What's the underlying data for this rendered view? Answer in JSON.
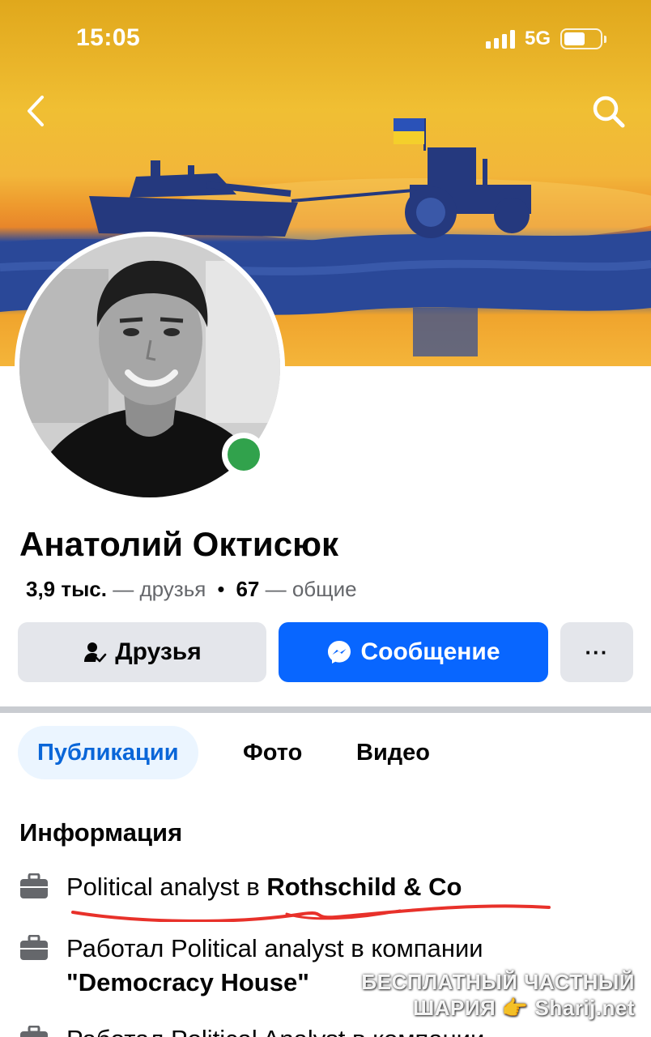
{
  "status_bar": {
    "time": "15:05",
    "network": "5G"
  },
  "profile": {
    "name": "Анатолий Октисюк",
    "friends_count": "3,9 тыс.",
    "friends_label": "— друзья",
    "separator": "•",
    "mutual_count": "67",
    "mutual_label": "— общие",
    "online": true
  },
  "actions": {
    "friends_label": "Друзья",
    "message_label": "Сообщение",
    "more_label": "···"
  },
  "tabs": [
    {
      "label": "Публикации",
      "active": true
    },
    {
      "label": "Фото",
      "active": false
    },
    {
      "label": "Видео",
      "active": false
    }
  ],
  "info": {
    "title": "Информация",
    "items": [
      {
        "prefix": "Political analyst в ",
        "bold": "Rothschild & Co",
        "icon": "briefcase-icon"
      },
      {
        "prefix": "Работал Political analyst в компании",
        "bold": "\"Democracy House\"",
        "icon": "briefcase-icon"
      },
      {
        "prefix": "Работал Political Analyst в компании",
        "bold": "",
        "icon": "briefcase-icon"
      }
    ]
  },
  "watermark": {
    "line1": "БЕСПЛАТНЫЙ ЧАСТНЫЙ",
    "line2": "ШАРИЯ 👉 Sharij.net"
  },
  "colors": {
    "primary": "#0866ff",
    "online": "#31a24c",
    "secondary_button": "#e4e6eb",
    "active_tab_bg": "#ebf5ff",
    "active_tab_text": "#0a66d8",
    "annotation_red": "#e8312a"
  }
}
